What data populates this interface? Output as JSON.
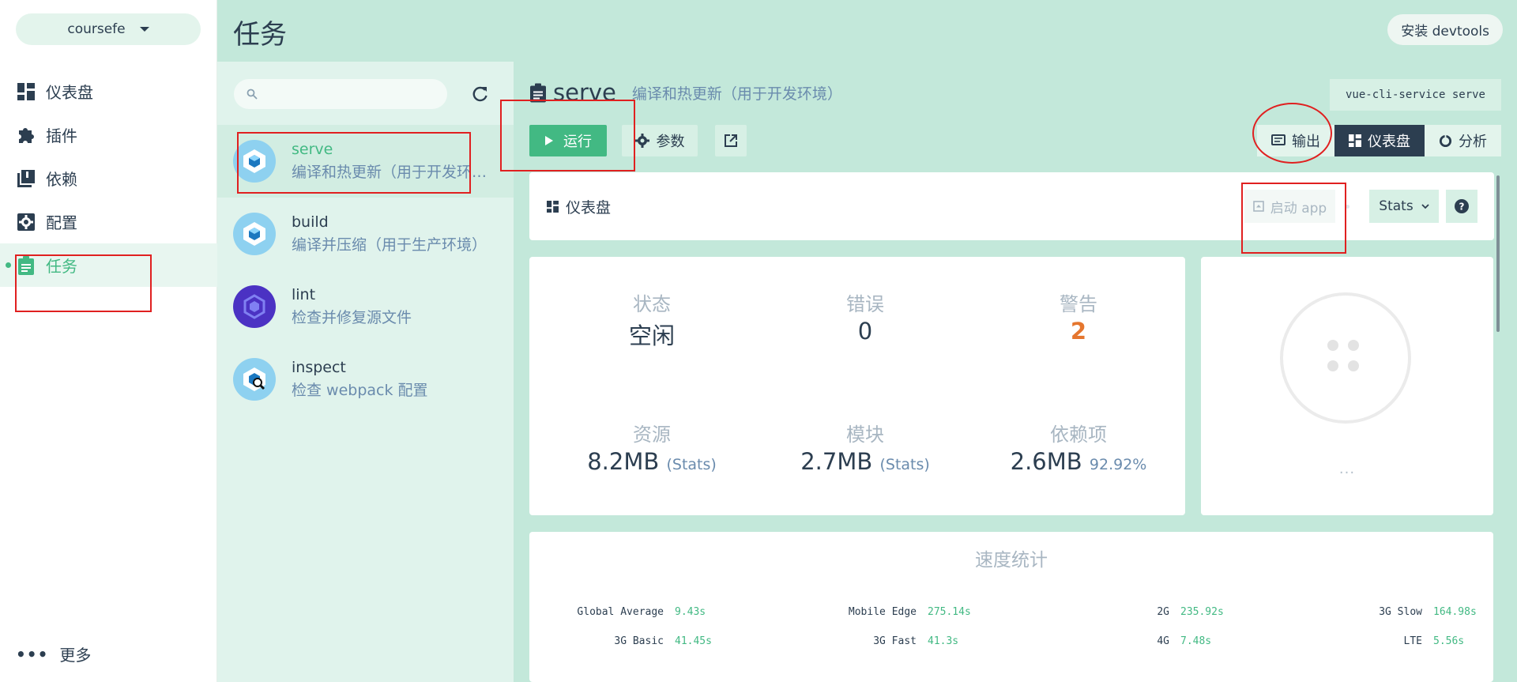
{
  "project": {
    "name": "coursefe"
  },
  "sidebar": {
    "items": [
      {
        "label": "仪表盘",
        "icon": "dashboard-icon"
      },
      {
        "label": "插件",
        "icon": "puzzle-icon"
      },
      {
        "label": "依赖",
        "icon": "library-icon"
      },
      {
        "label": "配置",
        "icon": "settings-icon"
      },
      {
        "label": "任务",
        "icon": "assignment-icon"
      }
    ],
    "more_label": "更多"
  },
  "header": {
    "title": "任务",
    "devtools_label": "安装 devtools"
  },
  "tasks": [
    {
      "name": "serve",
      "description": "编译和热更新（用于开发环境）",
      "icon": "webpack-icon"
    },
    {
      "name": "build",
      "description": "编译并压缩（用于生产环境）",
      "icon": "webpack-icon"
    },
    {
      "name": "lint",
      "description": "检查并修复源文件",
      "icon": "eslint-icon"
    },
    {
      "name": "inspect",
      "description": "检查 webpack 配置",
      "icon": "webpack-inspect-icon"
    }
  ],
  "task_detail": {
    "name": "serve",
    "description": "编译和热更新（用于开发环境）",
    "command": "vue-cli-service serve",
    "run_label": "运行",
    "params_label": "参数",
    "views": [
      "输出",
      "仪表盘",
      "分析"
    ],
    "active_view": "仪表盘"
  },
  "dashboard": {
    "title": "仪表盘",
    "start_app_label": "启动 app",
    "stats_select": "Stats",
    "status": {
      "label": "状态",
      "value": "空闲"
    },
    "errors": {
      "label": "错误",
      "value": "0"
    },
    "warnings": {
      "label": "警告",
      "value": "2"
    },
    "assets": {
      "label": "资源",
      "value": "8.2MB",
      "note": "(Stats)"
    },
    "modules": {
      "label": "模块",
      "value": "2.7MB",
      "note": "(Stats)"
    },
    "dependencies": {
      "label": "依赖项",
      "value": "2.6MB",
      "note": "92.92%"
    },
    "empty_ellipsis": "..."
  },
  "speed": {
    "title": "速度统计",
    "rows": [
      [
        {
          "name": "Global Average",
          "time": "9.43s"
        },
        {
          "name": "Mobile Edge",
          "time": "275.14s"
        },
        {
          "name": "2G",
          "time": "235.92s"
        },
        {
          "name": "3G Slow",
          "time": "164.98s"
        }
      ],
      [
        {
          "name": "3G Basic",
          "time": "41.45s"
        },
        {
          "name": "3G Fast",
          "time": "41.3s"
        },
        {
          "name": "4G",
          "time": "7.48s"
        },
        {
          "name": "LTE",
          "time": "5.56s"
        }
      ]
    ]
  },
  "colors": {
    "accent": "#42b983",
    "dark": "#2c3e50",
    "warning": "#e5762e",
    "annotation": "#e02020"
  }
}
